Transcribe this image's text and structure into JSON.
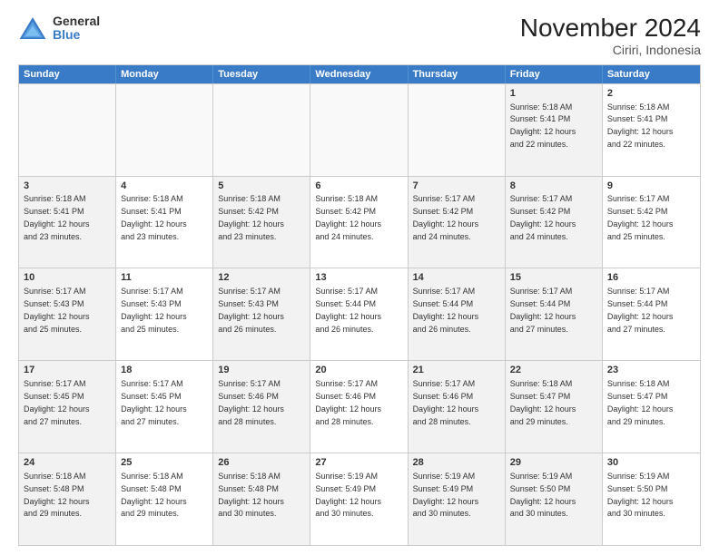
{
  "logo": {
    "general": "General",
    "blue": "Blue"
  },
  "title": "November 2024",
  "subtitle": "Ciriri, Indonesia",
  "header_days": [
    "Sunday",
    "Monday",
    "Tuesday",
    "Wednesday",
    "Thursday",
    "Friday",
    "Saturday"
  ],
  "weeks": [
    [
      {
        "day": "",
        "info": "",
        "empty": true
      },
      {
        "day": "",
        "info": "",
        "empty": true
      },
      {
        "day": "",
        "info": "",
        "empty": true
      },
      {
        "day": "",
        "info": "",
        "empty": true
      },
      {
        "day": "",
        "info": "",
        "empty": true
      },
      {
        "day": "1",
        "info": "Sunrise: 5:18 AM\nSunset: 5:41 PM\nDaylight: 12 hours\nand 22 minutes.",
        "shaded": true
      },
      {
        "day": "2",
        "info": "Sunrise: 5:18 AM\nSunset: 5:41 PM\nDaylight: 12 hours\nand 22 minutes."
      }
    ],
    [
      {
        "day": "3",
        "info": "Sunrise: 5:18 AM\nSunset: 5:41 PM\nDaylight: 12 hours\nand 23 minutes.",
        "shaded": true
      },
      {
        "day": "4",
        "info": "Sunrise: 5:18 AM\nSunset: 5:41 PM\nDaylight: 12 hours\nand 23 minutes."
      },
      {
        "day": "5",
        "info": "Sunrise: 5:18 AM\nSunset: 5:42 PM\nDaylight: 12 hours\nand 23 minutes.",
        "shaded": true
      },
      {
        "day": "6",
        "info": "Sunrise: 5:18 AM\nSunset: 5:42 PM\nDaylight: 12 hours\nand 24 minutes."
      },
      {
        "day": "7",
        "info": "Sunrise: 5:17 AM\nSunset: 5:42 PM\nDaylight: 12 hours\nand 24 minutes.",
        "shaded": true
      },
      {
        "day": "8",
        "info": "Sunrise: 5:17 AM\nSunset: 5:42 PM\nDaylight: 12 hours\nand 24 minutes.",
        "shaded": true
      },
      {
        "day": "9",
        "info": "Sunrise: 5:17 AM\nSunset: 5:42 PM\nDaylight: 12 hours\nand 25 minutes."
      }
    ],
    [
      {
        "day": "10",
        "info": "Sunrise: 5:17 AM\nSunset: 5:43 PM\nDaylight: 12 hours\nand 25 minutes.",
        "shaded": true
      },
      {
        "day": "11",
        "info": "Sunrise: 5:17 AM\nSunset: 5:43 PM\nDaylight: 12 hours\nand 25 minutes."
      },
      {
        "day": "12",
        "info": "Sunrise: 5:17 AM\nSunset: 5:43 PM\nDaylight: 12 hours\nand 26 minutes.",
        "shaded": true
      },
      {
        "day": "13",
        "info": "Sunrise: 5:17 AM\nSunset: 5:44 PM\nDaylight: 12 hours\nand 26 minutes."
      },
      {
        "day": "14",
        "info": "Sunrise: 5:17 AM\nSunset: 5:44 PM\nDaylight: 12 hours\nand 26 minutes.",
        "shaded": true
      },
      {
        "day": "15",
        "info": "Sunrise: 5:17 AM\nSunset: 5:44 PM\nDaylight: 12 hours\nand 27 minutes.",
        "shaded": true
      },
      {
        "day": "16",
        "info": "Sunrise: 5:17 AM\nSunset: 5:44 PM\nDaylight: 12 hours\nand 27 minutes."
      }
    ],
    [
      {
        "day": "17",
        "info": "Sunrise: 5:17 AM\nSunset: 5:45 PM\nDaylight: 12 hours\nand 27 minutes.",
        "shaded": true
      },
      {
        "day": "18",
        "info": "Sunrise: 5:17 AM\nSunset: 5:45 PM\nDaylight: 12 hours\nand 27 minutes."
      },
      {
        "day": "19",
        "info": "Sunrise: 5:17 AM\nSunset: 5:46 PM\nDaylight: 12 hours\nand 28 minutes.",
        "shaded": true
      },
      {
        "day": "20",
        "info": "Sunrise: 5:17 AM\nSunset: 5:46 PM\nDaylight: 12 hours\nand 28 minutes."
      },
      {
        "day": "21",
        "info": "Sunrise: 5:17 AM\nSunset: 5:46 PM\nDaylight: 12 hours\nand 28 minutes.",
        "shaded": true
      },
      {
        "day": "22",
        "info": "Sunrise: 5:18 AM\nSunset: 5:47 PM\nDaylight: 12 hours\nand 29 minutes.",
        "shaded": true
      },
      {
        "day": "23",
        "info": "Sunrise: 5:18 AM\nSunset: 5:47 PM\nDaylight: 12 hours\nand 29 minutes."
      }
    ],
    [
      {
        "day": "24",
        "info": "Sunrise: 5:18 AM\nSunset: 5:48 PM\nDaylight: 12 hours\nand 29 minutes.",
        "shaded": true
      },
      {
        "day": "25",
        "info": "Sunrise: 5:18 AM\nSunset: 5:48 PM\nDaylight: 12 hours\nand 29 minutes."
      },
      {
        "day": "26",
        "info": "Sunrise: 5:18 AM\nSunset: 5:48 PM\nDaylight: 12 hours\nand 30 minutes.",
        "shaded": true
      },
      {
        "day": "27",
        "info": "Sunrise: 5:19 AM\nSunset: 5:49 PM\nDaylight: 12 hours\nand 30 minutes."
      },
      {
        "day": "28",
        "info": "Sunrise: 5:19 AM\nSunset: 5:49 PM\nDaylight: 12 hours\nand 30 minutes.",
        "shaded": true
      },
      {
        "day": "29",
        "info": "Sunrise: 5:19 AM\nSunset: 5:50 PM\nDaylight: 12 hours\nand 30 minutes.",
        "shaded": true
      },
      {
        "day": "30",
        "info": "Sunrise: 5:19 AM\nSunset: 5:50 PM\nDaylight: 12 hours\nand 30 minutes."
      }
    ]
  ]
}
